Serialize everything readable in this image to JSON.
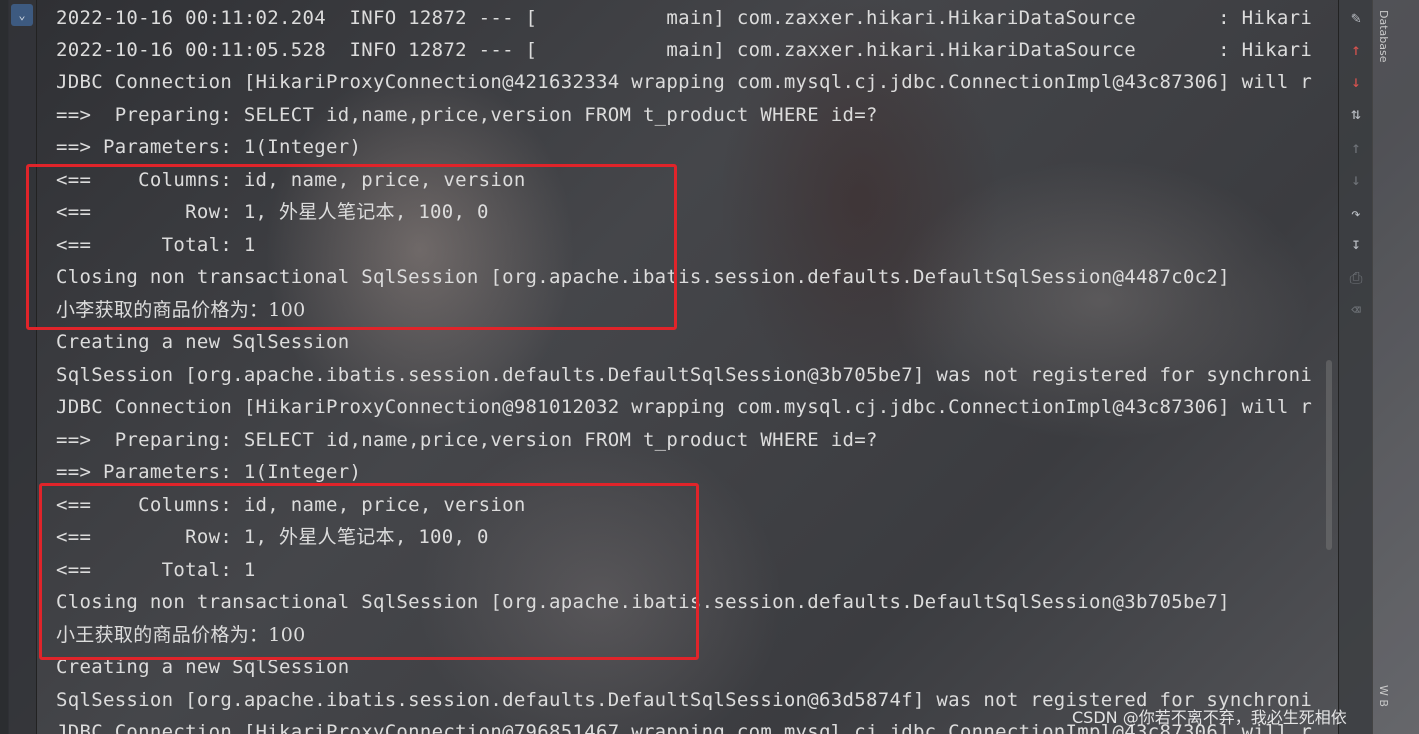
{
  "console": {
    "lines": [
      "2022-10-16 00:11:02.204  INFO 12872 --- [           main] com.zaxxer.hikari.HikariDataSource       : Hikari",
      "2022-10-16 00:11:05.528  INFO 12872 --- [           main] com.zaxxer.hikari.HikariDataSource       : Hikari",
      "JDBC Connection [HikariProxyConnection@421632334 wrapping com.mysql.cj.jdbc.ConnectionImpl@43c87306] will r",
      "==>  Preparing: SELECT id,name,price,version FROM t_product WHERE id=?",
      "==> Parameters: 1(Integer)",
      "<==    Columns: id, name, price, version",
      "<==        Row: 1, 外星人笔记本, 100, 0",
      "<==      Total: 1",
      "Closing non transactional SqlSession [org.apache.ibatis.session.defaults.DefaultSqlSession@4487c0c2]",
      "小李获取的商品价格为：100",
      "Creating a new SqlSession",
      "SqlSession [org.apache.ibatis.session.defaults.DefaultSqlSession@3b705be7] was not registered for synchroni",
      "JDBC Connection [HikariProxyConnection@981012032 wrapping com.mysql.cj.jdbc.ConnectionImpl@43c87306] will r",
      "==>  Preparing: SELECT id,name,price,version FROM t_product WHERE id=?",
      "==> Parameters: 1(Integer)",
      "<==    Columns: id, name, price, version",
      "<==        Row: 1, 外星人笔记本, 100, 0",
      "<==      Total: 1",
      "Closing non transactional SqlSession [org.apache.ibatis.session.defaults.DefaultSqlSession@3b705be7]",
      "小王获取的商品价格为：100",
      "Creating a new SqlSession",
      "SqlSession [org.apache.ibatis.session.defaults.DefaultSqlSession@63d5874f] was not registered for synchroni",
      "JDBC Connection [HikariProxyConnection@796851467 wrapping com.mysql.cj.jdbc.ConnectionImpl@43c87306] will r"
    ]
  },
  "right_toolbar": {
    "icons": [
      "edit-icon",
      "arrow-up-icon",
      "arrow-down-icon",
      "sort-icon",
      "up-icon",
      "down-icon",
      "soft-wrap-icon",
      "scroll-end-icon",
      "print-icon",
      "trash-icon"
    ]
  },
  "sidebar": {
    "database_label": "Database",
    "bottom_label": "W B"
  },
  "watermark": "CSDN @你若不离不弃，我必生死相依",
  "colors": {
    "highlight": "#e0242a",
    "text": "#dcdcdc"
  }
}
